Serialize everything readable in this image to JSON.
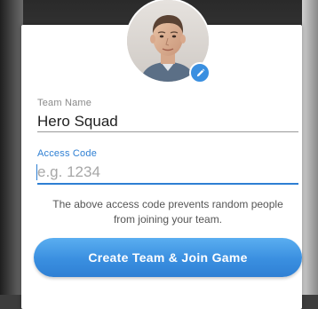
{
  "form": {
    "team_name": {
      "label": "Team Name",
      "value": "Hero Squad"
    },
    "access_code": {
      "label": "Access Code",
      "value": "",
      "placeholder": "e.g. 1234"
    },
    "helper_text": {
      "line1": "The above access code prevents random people",
      "line2": "from joining your team."
    },
    "submit_label": "Create Team & Join Game"
  },
  "icons": {
    "avatar": "user-avatar-photo",
    "edit": "pencil-icon"
  },
  "colors": {
    "accent": "#2e7fd3",
    "button": "#3a8fe0",
    "label_muted": "#8a8a8a",
    "text": "#1f1f1f"
  }
}
